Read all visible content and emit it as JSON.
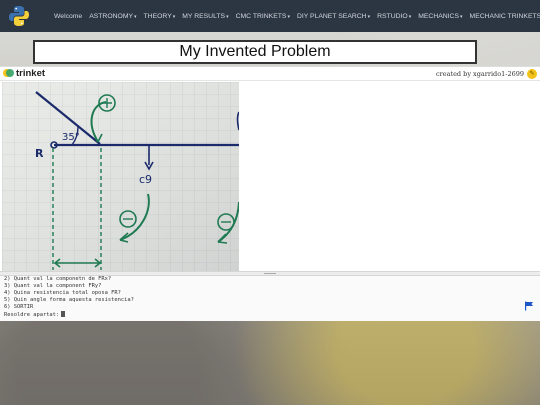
{
  "nav": {
    "items": [
      {
        "label": "Welcome",
        "has_caret": false
      },
      {
        "label": "ASTRONOMY",
        "has_caret": true
      },
      {
        "label": "THEORY",
        "has_caret": true
      },
      {
        "label": "MY RESULTS",
        "has_caret": true
      },
      {
        "label": "CMC TRINKETS",
        "has_caret": true
      },
      {
        "label": "DIY PLANET SEARCH",
        "has_caret": true
      },
      {
        "label": "RSTUDIO",
        "has_caret": true
      },
      {
        "label": "MECHANICS",
        "has_caret": true
      },
      {
        "label": "MECHANIC TRINKETS",
        "has_caret": true
      }
    ],
    "caret": "▾"
  },
  "page": {
    "title": "My Invented Problem"
  },
  "trinket": {
    "brand": "trinket",
    "created_by": "created by xgarrido1-2699",
    "diagram": {
      "label_r": "R",
      "angle": "35°",
      "value_text": "c9"
    },
    "console": [
      "2) Quant val la componetn de FRx?",
      "3) Quant val la component FRy?",
      "4) Quina resistencia total oposa FR?",
      "5) Quin angle forma aquesta resistencia?",
      "6) SORTIR",
      "Resoldre apartat:"
    ]
  },
  "colors": {
    "navbar": "#2c3542",
    "ink_green": "#1f7a52",
    "ink_blue": "#1a2a6a",
    "flag": "#1e55c8"
  }
}
